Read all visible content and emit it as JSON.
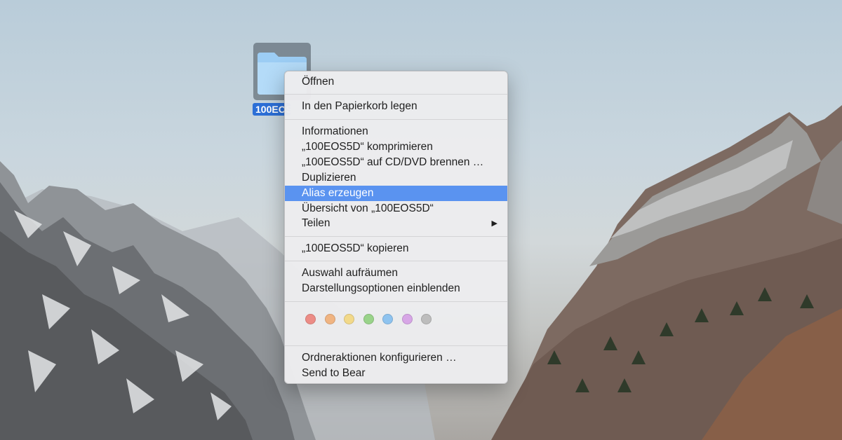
{
  "desktop": {
    "folder_name": "100EOS5D"
  },
  "menu": {
    "items": [
      {
        "label": "Öffnen"
      },
      {
        "label": "In den Papierkorb legen"
      },
      {
        "label": "Informationen"
      },
      {
        "label": "„100EOS5D“ komprimieren"
      },
      {
        "label": "„100EOS5D“ auf CD/DVD brennen …"
      },
      {
        "label": "Duplizieren"
      },
      {
        "label": "Alias erzeugen",
        "highlighted": true
      },
      {
        "label": "Übersicht von „100EOS5D“"
      },
      {
        "label": "Teilen",
        "submenu_arrow": "▶"
      },
      {
        "label": "„100EOS5D“ kopieren"
      },
      {
        "label": "Auswahl aufräumen"
      },
      {
        "label": "Darstellungsoptionen einblenden"
      },
      {
        "label": "Ordneraktionen konfigurieren …"
      },
      {
        "label": "Send to Bear"
      }
    ],
    "tag_colors": [
      {
        "name": "red-tag",
        "color": "#ec8c86"
      },
      {
        "name": "orange-tag",
        "color": "#f0b482"
      },
      {
        "name": "yellow-tag",
        "color": "#f2d98a"
      },
      {
        "name": "green-tag",
        "color": "#99d38a"
      },
      {
        "name": "blue-tag",
        "color": "#8ec3ef"
      },
      {
        "name": "purple-tag",
        "color": "#d7a6e6"
      },
      {
        "name": "gray-tag",
        "color": "#bdbdbd"
      }
    ],
    "highlight_color": "#5a93f0"
  }
}
